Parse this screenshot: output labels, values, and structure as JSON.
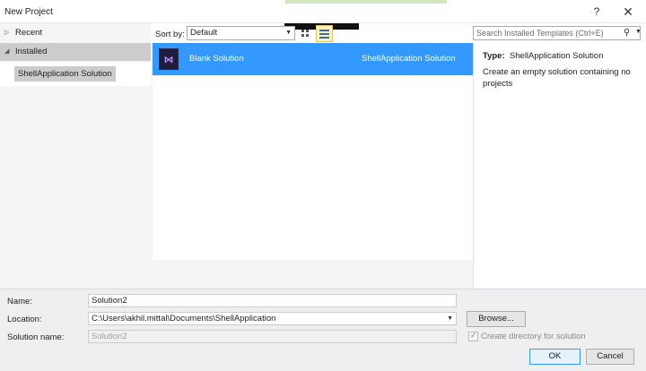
{
  "window": {
    "title": "New Project",
    "help_glyph": "?",
    "close_glyph": "✕"
  },
  "tree": {
    "recent": "Recent",
    "installed": "Installed",
    "selected_item": "ShellApplication Solution"
  },
  "toolbar": {
    "sort_label": "Sort by:",
    "sort_value": "Default",
    "search_placeholder": "Search Installed Templates (Ctrl+E)"
  },
  "templates": [
    {
      "name": "Blank Solution",
      "type": "ShellApplication Solution",
      "selected": true
    }
  ],
  "details": {
    "type_label": "Type:",
    "type_value": "ShellApplication Solution",
    "description": "Create an empty solution containing no projects"
  },
  "form": {
    "name_label": "Name:",
    "name_value": "Solution2",
    "location_label": "Location:",
    "location_value": "C:\\Users\\akhil.mittal\\Documents\\ShellApplication",
    "solution_name_label": "Solution name:",
    "solution_name_value": "Solution2",
    "browse_label": "Browse...",
    "create_dir_label": "Create directory for solution",
    "create_dir_checked": true,
    "ok_label": "OK",
    "cancel_label": "Cancel"
  },
  "colors": {
    "selection": "#3399ff",
    "panel_bg": "#f5f5f5",
    "footer_bg": "#efeff2"
  },
  "icons": [
    "expand-arrow-icon",
    "collapse-arrow-icon",
    "dropdown-arrow-icon",
    "grid-view-icon",
    "list-view-icon",
    "search-icon",
    "visual-studio-solution-icon",
    "checkmark-icon"
  ]
}
